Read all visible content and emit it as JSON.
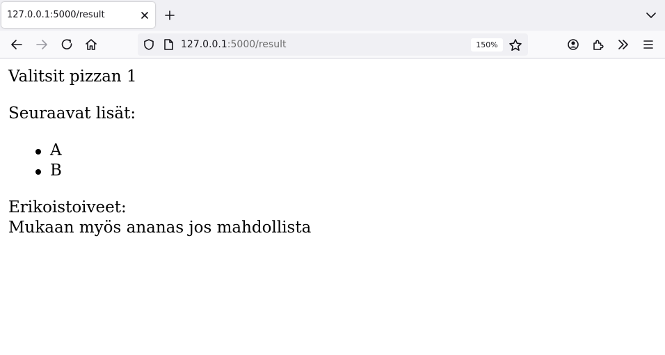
{
  "tab": {
    "title": "127.0.0.1:5000/result"
  },
  "urlbar": {
    "host": "127.0.0.1",
    "path": ":5000/result",
    "zoom": "150%"
  },
  "page": {
    "choice": "Valitsit pizzan 1",
    "toppings_heading": "Seuraavat lisät:",
    "toppings": [
      "A",
      "B"
    ],
    "special_label": "Erikoistoiveet:",
    "special_text": "Mukaan myös ananas jos mahdollista"
  },
  "icons": {
    "tab_close": "close-icon",
    "new_tab": "plus-icon",
    "tab_list": "chevron-down-icon",
    "back": "arrow-left-icon",
    "forward": "arrow-right-icon",
    "reload": "reload-icon",
    "home": "home-icon",
    "shield": "shield-icon",
    "page": "page-icon",
    "bookmark": "star-icon",
    "account": "account-icon",
    "extensions": "puzzle-icon",
    "overflow": "double-chevron-icon",
    "menu": "hamburger-menu-icon"
  }
}
